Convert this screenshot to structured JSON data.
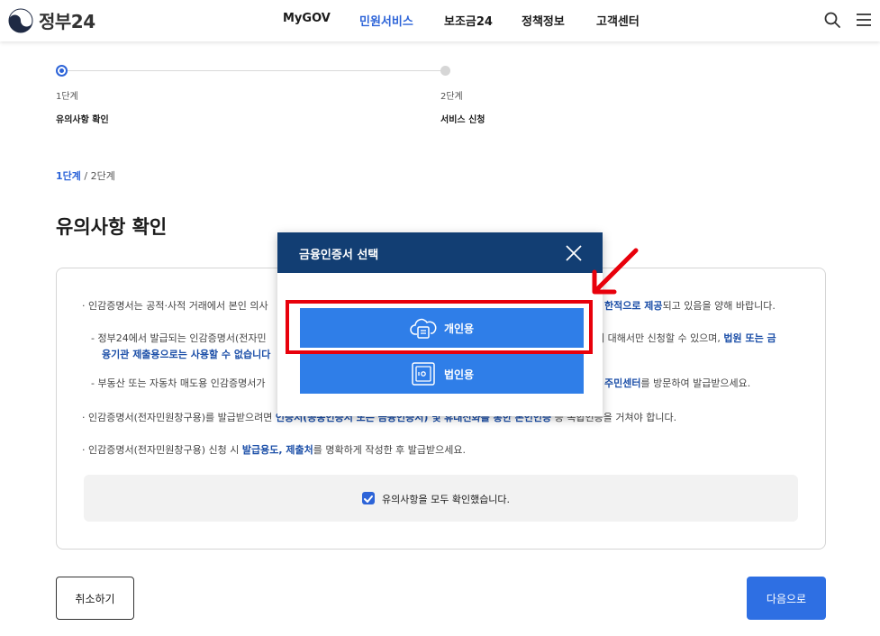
{
  "header": {
    "logo_text": "정부24",
    "nav": [
      "MyGOV",
      "민원서비스",
      "보조금24",
      "정책정보",
      "고객센터"
    ],
    "active_nav": "민원서비스",
    "search_icon": "search-icon",
    "menu_icon": "menu-icon",
    "accent_color": "#2d64d8"
  },
  "stepper": {
    "steps": [
      {
        "num": "1단계",
        "name": "유의사항 확인"
      },
      {
        "num": "2단계",
        "name": "서비스 신청"
      }
    ]
  },
  "breadcrumb": {
    "current": "1단계",
    "separator": " / ",
    "next": "2단계"
  },
  "page_title": "유의사항 확인",
  "notice": {
    "l1a": "인감증명서는 공적·사적 거래에서 본인 의사",
    "l1b": "한적으로 제공",
    "l1c": "되고 있음을 양해 바랍니다.",
    "l2a": "- 정부24에서 발급되는 인감증명서(전자민",
    "l2b": "에 대해서만 신청할 수 있으며, ",
    "l2c": "법원 또는 금",
    "l3a": "융기관 제출용으로는 사용할 수 없습니다",
    "l4a": "- 부동산 또는 자동차 매도용 인감증명서가",
    "l4b": "주민센터",
    "l4c": "를 방문하여 발급받으세요.",
    "l5a": "인감증명서(전자민원창구용)를 발급받으려면 ",
    "l5b": "인증서(공동인증서 또는 금융인증서) 및 휴대전화를 통한 본인인증",
    "l5c": "등 복합인증을 거쳐야 합니다.",
    "l6a": "인감증명서(전자민원창구용) 신청 시 ",
    "l6b": "발급용도, 제출처",
    "l6c": "를 명확하게 작성한 후 발급받으세요.",
    "confirm_label": "유의사항을 모두 확인했습니다."
  },
  "buttons": {
    "cancel": "취소하기",
    "next": "다음으로"
  },
  "modal": {
    "title": "금융인증서 선택",
    "close_icon": "close-icon",
    "options": [
      "개인용",
      "법인용"
    ],
    "header_color": "#123e73",
    "button_color": "#2f7ee8",
    "highlight_color": "#e8000b"
  }
}
